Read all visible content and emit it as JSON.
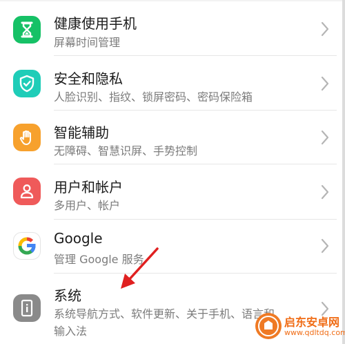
{
  "settings": {
    "items": [
      {
        "title": "健康使用手机",
        "subtitle": "屏幕时间管理",
        "icon": "hourglass-icon",
        "color": "#16c166"
      },
      {
        "title": "安全和隐私",
        "subtitle": "人脸识别、指纹、锁屏密码、密码保险箱",
        "icon": "shield-check-icon",
        "color": "#1fcdb8"
      },
      {
        "title": "智能辅助",
        "subtitle": "无障碍、智慧识屏、手势控制",
        "icon": "hand-icon",
        "color": "#f7a12d"
      },
      {
        "title": "用户和帐户",
        "subtitle": "多用户、帐户",
        "icon": "user-icon",
        "color": "#ef5a5a"
      },
      {
        "title": "Google",
        "subtitle": "管理 Google 服务",
        "icon": "google-icon",
        "color": "#ffffff"
      },
      {
        "title": "系统",
        "subtitle": "系统导航方式、软件更新、关于手机、语言和",
        "subtitle2": "输入法",
        "icon": "phone-info-icon",
        "color": "#8a8a8a"
      }
    ]
  },
  "watermark": {
    "name": "启东安卓网",
    "url": "www.qdltdq.com"
  },
  "annotation": {
    "color": "#e02020",
    "icon": "red-arrow-icon"
  }
}
